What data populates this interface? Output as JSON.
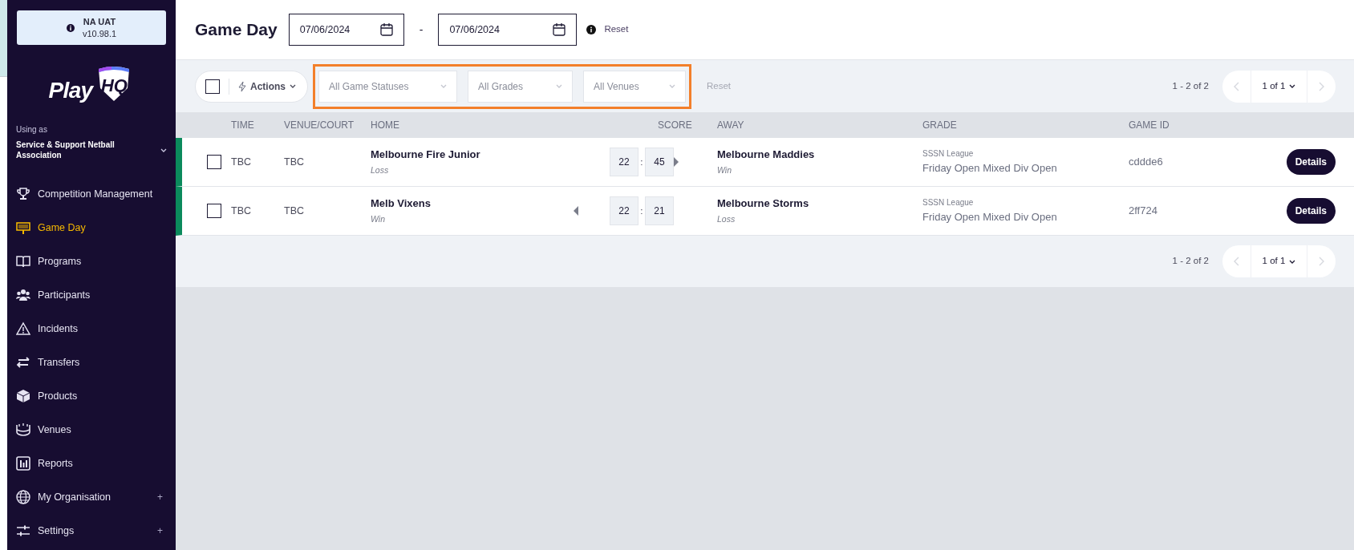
{
  "environment": {
    "name": "NA UAT",
    "version": "v10.98.1"
  },
  "logo": {
    "text": "Play",
    "badge": "HQ"
  },
  "org": {
    "caption": "Using as",
    "name": "Service & Support Netball Association"
  },
  "nav": [
    {
      "label": "Competition Management",
      "selected": false
    },
    {
      "label": "Game Day",
      "selected": true
    },
    {
      "label": "Programs",
      "selected": false
    },
    {
      "label": "Participants",
      "selected": false
    },
    {
      "label": "Incidents",
      "selected": false
    },
    {
      "label": "Transfers",
      "selected": false
    },
    {
      "label": "Products",
      "selected": false
    },
    {
      "label": "Venues",
      "selected": false
    },
    {
      "label": "Reports",
      "selected": false
    },
    {
      "label": "My Organisation",
      "selected": false,
      "suffix": "+"
    },
    {
      "label": "Settings",
      "selected": false,
      "suffix": "+"
    }
  ],
  "header": {
    "title": "Game Day",
    "date_from": "07/06/2024",
    "separator": "-",
    "date_to": "07/06/2024",
    "reset": "Reset"
  },
  "toolbar": {
    "select_all": {
      "checked": false
    },
    "actions": "Actions",
    "filters": [
      {
        "placeholder": "All Game Statuses"
      },
      {
        "placeholder": "All Grades"
      },
      {
        "placeholder": "All Venues"
      }
    ],
    "reset": "Reset",
    "range": "1 - 2 of 2",
    "page": "1 of 1"
  },
  "table": {
    "columns": [
      "TIME",
      "VENUE/COURT",
      "HOME",
      "SCORE",
      "AWAY",
      "GRADE",
      "GAME ID"
    ],
    "rows": [
      {
        "checked": false,
        "time": "TBC",
        "venue": "TBC",
        "home": "Melbourne Fire Junior",
        "home_result": "Loss",
        "home_score": "22",
        "score_separator": ":",
        "away_score": "45",
        "home_won": false,
        "away_won": true,
        "away": "Melbourne Maddies",
        "away_result": "Win",
        "competition": "SSSN League",
        "grade": "Friday Open Mixed Div Open",
        "game_id": "cddde6",
        "action": "Details"
      },
      {
        "checked": false,
        "time": "TBC",
        "venue": "TBC",
        "home": "Melb Vixens",
        "home_result": "Win",
        "home_score": "22",
        "score_separator": ":",
        "away_score": "21",
        "home_won": true,
        "away_won": false,
        "away": "Melbourne Storms",
        "away_result": "Loss",
        "competition": "SSSN League",
        "grade": "Friday Open Mixed Div Open",
        "game_id": "2ff724",
        "action": "Details"
      }
    ]
  },
  "footer": {
    "range": "1 - 2 of 2",
    "page": "1 of 1"
  }
}
